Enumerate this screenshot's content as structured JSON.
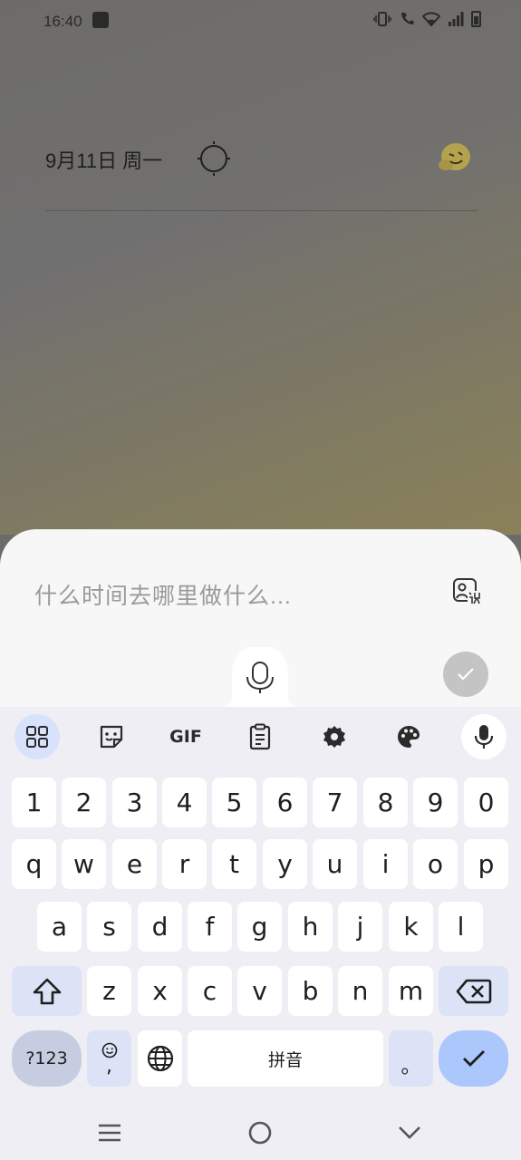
{
  "status_bar": {
    "time": "16:40"
  },
  "header": {
    "date": "9月11日 周一"
  },
  "composer": {
    "placeholder": "什么时间去哪里做什么..."
  },
  "keyboard": {
    "toolbar": {
      "gif_label": "GIF"
    },
    "rows": {
      "numbers": [
        "1",
        "2",
        "3",
        "4",
        "5",
        "6",
        "7",
        "8",
        "9",
        "0"
      ],
      "row1": [
        "q",
        "w",
        "e",
        "r",
        "t",
        "y",
        "u",
        "i",
        "o",
        "p"
      ],
      "row2": [
        "a",
        "s",
        "d",
        "f",
        "g",
        "h",
        "j",
        "k",
        "l"
      ],
      "row3": [
        "z",
        "x",
        "c",
        "v",
        "b",
        "n",
        "m"
      ]
    },
    "symbols_label": "?123",
    "comma_label": ",",
    "space_label": "拼音",
    "period_label": "。"
  },
  "colors": {
    "accent": "#abc7fb",
    "apps_button_bg": "#d8e2fb",
    "sheet_bg": "#f8f7f8",
    "keyboard_bg": "#f0eef5",
    "scrim": "#6b6b6b"
  },
  "icons": [
    "vibrate-icon",
    "wifi-call-icon",
    "wifi-icon",
    "signal-icon",
    "battery-icon",
    "sun-icon",
    "emoji-sticker-icon",
    "image-ocr-icon",
    "microphone-icon",
    "check-icon",
    "apps-grid-icon",
    "sticker-icon",
    "clipboard-icon",
    "gear-icon",
    "palette-icon",
    "shift-icon",
    "backspace-icon",
    "emoji-icon",
    "globe-icon",
    "menu-icon",
    "home-icon",
    "back-icon"
  ]
}
